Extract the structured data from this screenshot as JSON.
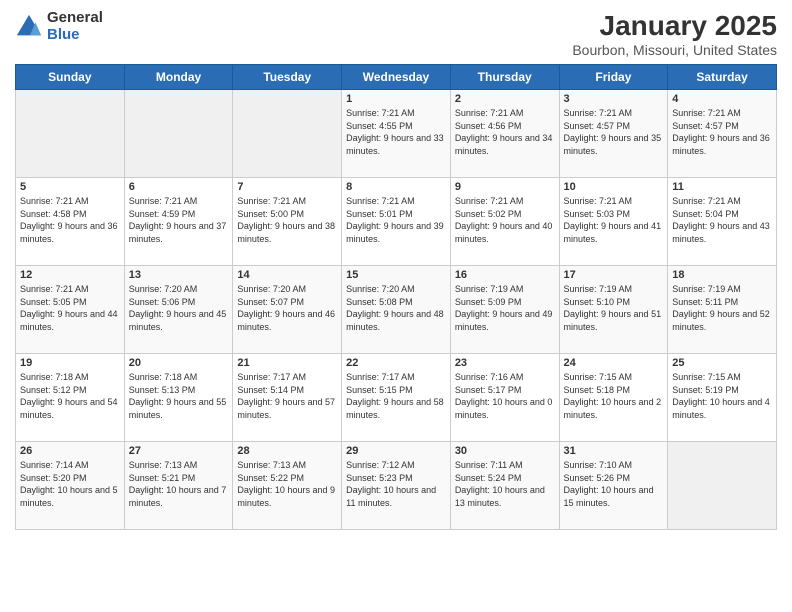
{
  "header": {
    "logo_general": "General",
    "logo_blue": "Blue",
    "title": "January 2025",
    "subtitle": "Bourbon, Missouri, United States"
  },
  "days_of_week": [
    "Sunday",
    "Monday",
    "Tuesday",
    "Wednesday",
    "Thursday",
    "Friday",
    "Saturday"
  ],
  "weeks": [
    [
      {
        "day": "",
        "info": ""
      },
      {
        "day": "",
        "info": ""
      },
      {
        "day": "",
        "info": ""
      },
      {
        "day": "1",
        "info": "Sunrise: 7:21 AM\nSunset: 4:55 PM\nDaylight: 9 hours and 33 minutes."
      },
      {
        "day": "2",
        "info": "Sunrise: 7:21 AM\nSunset: 4:56 PM\nDaylight: 9 hours and 34 minutes."
      },
      {
        "day": "3",
        "info": "Sunrise: 7:21 AM\nSunset: 4:57 PM\nDaylight: 9 hours and 35 minutes."
      },
      {
        "day": "4",
        "info": "Sunrise: 7:21 AM\nSunset: 4:57 PM\nDaylight: 9 hours and 36 minutes."
      }
    ],
    [
      {
        "day": "5",
        "info": "Sunrise: 7:21 AM\nSunset: 4:58 PM\nDaylight: 9 hours and 36 minutes."
      },
      {
        "day": "6",
        "info": "Sunrise: 7:21 AM\nSunset: 4:59 PM\nDaylight: 9 hours and 37 minutes."
      },
      {
        "day": "7",
        "info": "Sunrise: 7:21 AM\nSunset: 5:00 PM\nDaylight: 9 hours and 38 minutes."
      },
      {
        "day": "8",
        "info": "Sunrise: 7:21 AM\nSunset: 5:01 PM\nDaylight: 9 hours and 39 minutes."
      },
      {
        "day": "9",
        "info": "Sunrise: 7:21 AM\nSunset: 5:02 PM\nDaylight: 9 hours and 40 minutes."
      },
      {
        "day": "10",
        "info": "Sunrise: 7:21 AM\nSunset: 5:03 PM\nDaylight: 9 hours and 41 minutes."
      },
      {
        "day": "11",
        "info": "Sunrise: 7:21 AM\nSunset: 5:04 PM\nDaylight: 9 hours and 43 minutes."
      }
    ],
    [
      {
        "day": "12",
        "info": "Sunrise: 7:21 AM\nSunset: 5:05 PM\nDaylight: 9 hours and 44 minutes."
      },
      {
        "day": "13",
        "info": "Sunrise: 7:20 AM\nSunset: 5:06 PM\nDaylight: 9 hours and 45 minutes."
      },
      {
        "day": "14",
        "info": "Sunrise: 7:20 AM\nSunset: 5:07 PM\nDaylight: 9 hours and 46 minutes."
      },
      {
        "day": "15",
        "info": "Sunrise: 7:20 AM\nSunset: 5:08 PM\nDaylight: 9 hours and 48 minutes."
      },
      {
        "day": "16",
        "info": "Sunrise: 7:19 AM\nSunset: 5:09 PM\nDaylight: 9 hours and 49 minutes."
      },
      {
        "day": "17",
        "info": "Sunrise: 7:19 AM\nSunset: 5:10 PM\nDaylight: 9 hours and 51 minutes."
      },
      {
        "day": "18",
        "info": "Sunrise: 7:19 AM\nSunset: 5:11 PM\nDaylight: 9 hours and 52 minutes."
      }
    ],
    [
      {
        "day": "19",
        "info": "Sunrise: 7:18 AM\nSunset: 5:12 PM\nDaylight: 9 hours and 54 minutes."
      },
      {
        "day": "20",
        "info": "Sunrise: 7:18 AM\nSunset: 5:13 PM\nDaylight: 9 hours and 55 minutes."
      },
      {
        "day": "21",
        "info": "Sunrise: 7:17 AM\nSunset: 5:14 PM\nDaylight: 9 hours and 57 minutes."
      },
      {
        "day": "22",
        "info": "Sunrise: 7:17 AM\nSunset: 5:15 PM\nDaylight: 9 hours and 58 minutes."
      },
      {
        "day": "23",
        "info": "Sunrise: 7:16 AM\nSunset: 5:17 PM\nDaylight: 10 hours and 0 minutes."
      },
      {
        "day": "24",
        "info": "Sunrise: 7:15 AM\nSunset: 5:18 PM\nDaylight: 10 hours and 2 minutes."
      },
      {
        "day": "25",
        "info": "Sunrise: 7:15 AM\nSunset: 5:19 PM\nDaylight: 10 hours and 4 minutes."
      }
    ],
    [
      {
        "day": "26",
        "info": "Sunrise: 7:14 AM\nSunset: 5:20 PM\nDaylight: 10 hours and 5 minutes."
      },
      {
        "day": "27",
        "info": "Sunrise: 7:13 AM\nSunset: 5:21 PM\nDaylight: 10 hours and 7 minutes."
      },
      {
        "day": "28",
        "info": "Sunrise: 7:13 AM\nSunset: 5:22 PM\nDaylight: 10 hours and 9 minutes."
      },
      {
        "day": "29",
        "info": "Sunrise: 7:12 AM\nSunset: 5:23 PM\nDaylight: 10 hours and 11 minutes."
      },
      {
        "day": "30",
        "info": "Sunrise: 7:11 AM\nSunset: 5:24 PM\nDaylight: 10 hours and 13 minutes."
      },
      {
        "day": "31",
        "info": "Sunrise: 7:10 AM\nSunset: 5:26 PM\nDaylight: 10 hours and 15 minutes."
      },
      {
        "day": "",
        "info": ""
      }
    ]
  ]
}
